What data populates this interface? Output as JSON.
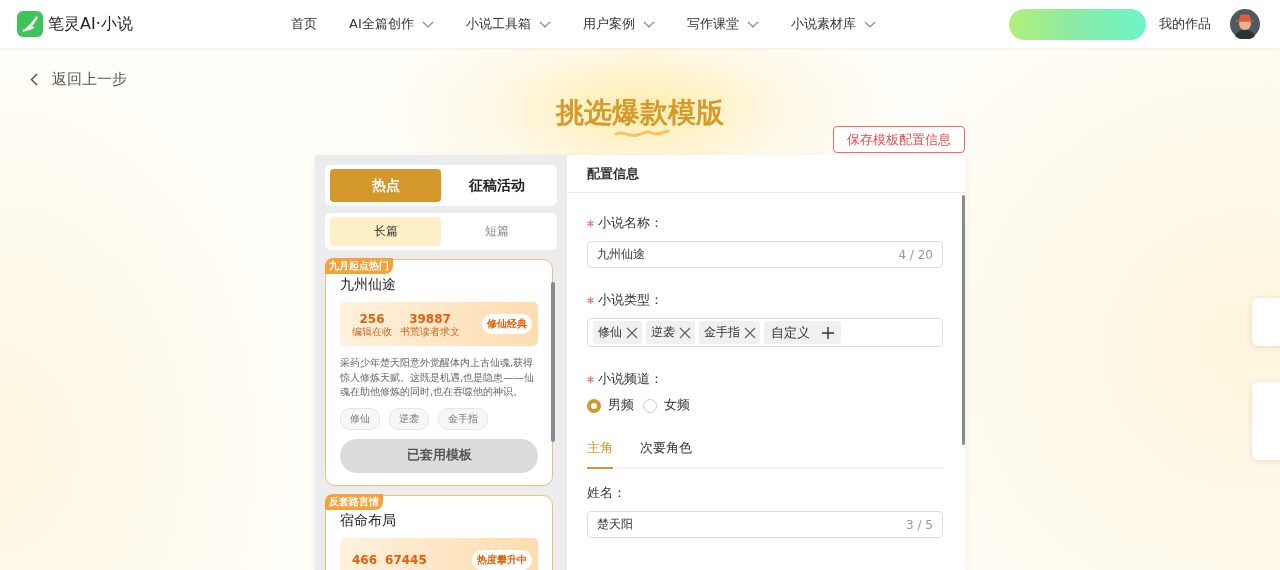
{
  "header": {
    "logo_text": "笔灵AI·小说",
    "nav": [
      {
        "label": "首页",
        "dropdown": false
      },
      {
        "label": "AI全篇创作",
        "dropdown": true
      },
      {
        "label": "小说工具箱",
        "dropdown": true
      },
      {
        "label": "用户案例",
        "dropdown": true
      },
      {
        "label": "写作课堂",
        "dropdown": true
      },
      {
        "label": "小说素材库",
        "dropdown": true
      }
    ],
    "my_works": "我的作品"
  },
  "back_link": "返回上一步",
  "page_title": "挑选爆款模版",
  "save_button": "保存模板配置信息",
  "category_tabs": [
    {
      "label": "热点",
      "selected": true
    },
    {
      "label": "征稿活动",
      "selected": false
    }
  ],
  "length_tabs": [
    {
      "label": "长篇",
      "selected": true
    },
    {
      "label": "短篇",
      "selected": false
    }
  ],
  "templates": [
    {
      "badge": "九月起点热门",
      "title": "九州仙途",
      "stats": [
        {
          "value": "256",
          "label": "编辑在收"
        },
        {
          "value": "39887",
          "label": "书荒读者求文"
        }
      ],
      "highlight": "修仙经典",
      "description": "采药少年楚天阳意外觉醒体内上古仙魂,获得惊人修炼天赋。这既是机遇,也是隐患——仙魂在助他修炼的同时,也在吞噬他的神识。",
      "tags": [
        "修仙",
        "逆袭",
        "金手指"
      ],
      "button": "已套用模板",
      "applied": true
    },
    {
      "badge": "反套路言情",
      "title": "宿命布局",
      "stats": [
        {
          "value": "466"
        },
        {
          "value": "67445"
        }
      ],
      "highlight": "热度攀升中"
    }
  ],
  "config": {
    "title": "配置信息",
    "fields": [
      {
        "kind": "text",
        "label": "小说名称：",
        "required": true,
        "value": "九州仙途",
        "counter": "4 / 20"
      },
      {
        "kind": "tags",
        "label": "小说类型：",
        "required": true,
        "tags": [
          "修仙",
          "逆袭",
          "金手指"
        ],
        "custom": "自定义"
      },
      {
        "kind": "radio",
        "label": "小说频道：",
        "required": true,
        "options": [
          {
            "label": "男频",
            "selected": true
          },
          {
            "label": "女频",
            "selected": false
          }
        ]
      }
    ],
    "role_tabs": [
      {
        "label": "主角",
        "selected": true
      },
      {
        "label": "次要角色",
        "selected": false
      }
    ],
    "name_field": {
      "label": "姓名：",
      "value": "楚天阳",
      "counter": "3 / 5"
    }
  }
}
